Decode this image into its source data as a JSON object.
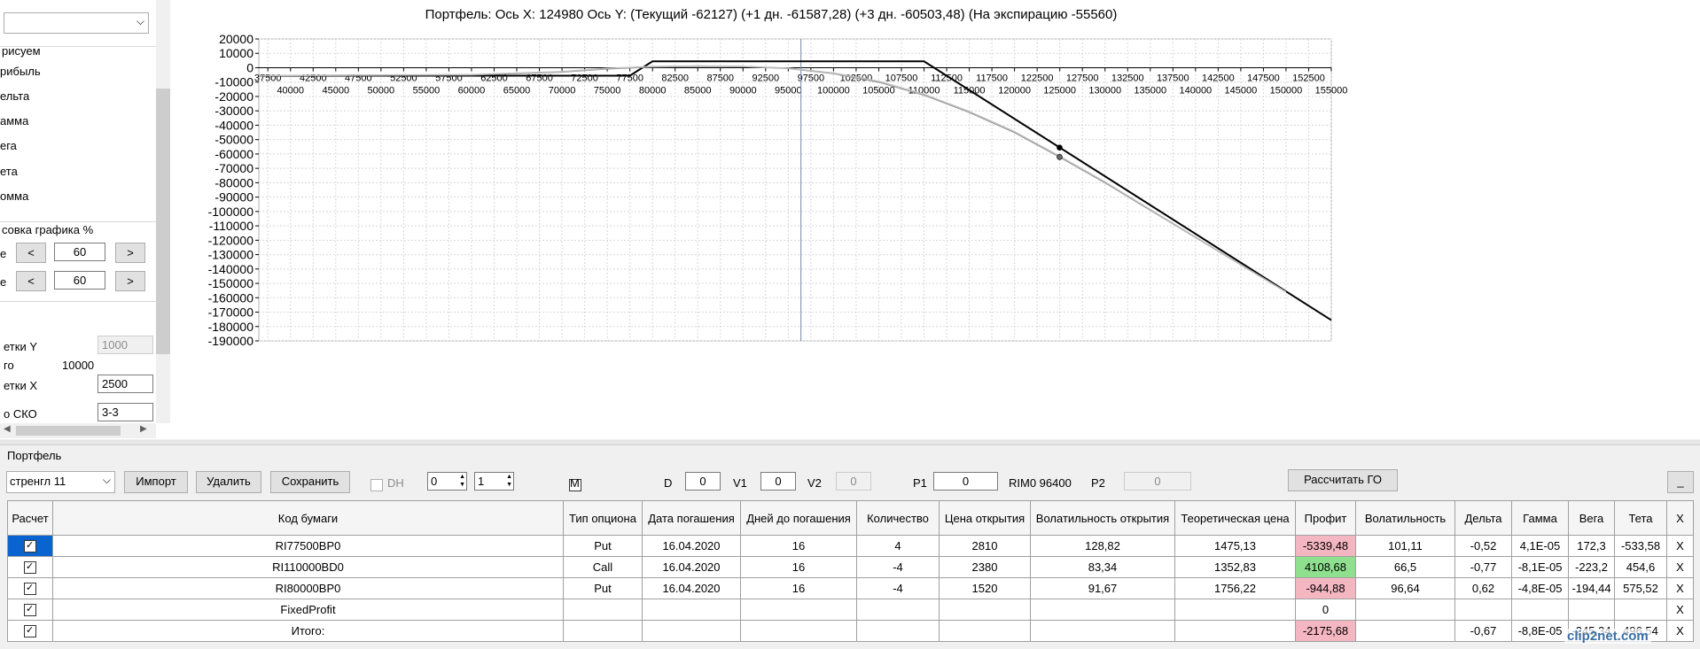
{
  "left_panel": {
    "top_combo_value": "",
    "draw_header": "рисуем",
    "checks": [
      "рибыль",
      "ельта",
      "амма",
      "ега",
      "ета",
      "омма"
    ],
    "scale_header": "совка графика %",
    "scale_row1_prefix": "е",
    "scale_row1_value": "60",
    "scale_row2_prefix": "е",
    "scale_row2_value": "60",
    "btn_less": "<",
    "btn_more": ">",
    "grid_y_label": "етки Y",
    "grid_y_value": "1000",
    "step_label": "го",
    "step_value": "10000",
    "grid_x_label": "етки X",
    "grid_x_value": "2500",
    "sko_label": "о СКО",
    "sko_value": "3-3"
  },
  "chart": {
    "title": "Портфель: Ось X: 124980 Ось Y:  (Текущий -62127)  (+1 дн. -61587,28)  (+3 дн. -60503,48)  (На экспирацию -55560)",
    "y_ticks": [
      20000,
      10000,
      0,
      -10000,
      -20000,
      -30000,
      -40000,
      -50000,
      -60000,
      -70000,
      -80000,
      -90000,
      -100000,
      -110000,
      -120000,
      -130000,
      -140000,
      -150000,
      -160000,
      -170000,
      -180000,
      -190000
    ],
    "x_ticks_upper": [
      37500,
      42500,
      47500,
      52500,
      57500,
      62500,
      67500,
      72500,
      77500,
      82500,
      87500,
      92500,
      97500,
      102500,
      107500,
      112500,
      117500,
      122500,
      127500,
      132500,
      137500,
      142500,
      147500,
      152500
    ],
    "x_ticks_lower": [
      40000,
      45000,
      50000,
      55000,
      60000,
      65000,
      70000,
      75000,
      80000,
      85000,
      90000,
      95000,
      100000,
      105000,
      110000,
      115000,
      120000,
      125000,
      130000,
      135000,
      140000,
      145000,
      150000,
      155000
    ],
    "cursor_x": 96400,
    "marker_x": 124980,
    "colors": {
      "expiration": "#000000",
      "current": "#9a9a9a",
      "cursor": "#7a8aa8",
      "grid": "#d8d8d8"
    }
  },
  "chart_data": {
    "type": "line",
    "title": "Портфель: Ось X: 124980 Ось Y:  (Текущий -62127)  (+1 дн. -61587,28)  (+3 дн. -60503,48)  (На экспирацию -55560)",
    "xlim": [
      36500,
      155000
    ],
    "ylim": [
      -190000,
      20000
    ],
    "series": [
      {
        "x": [
          36500,
          77500,
          80000,
          110000,
          155000
        ],
        "values": [
          -5560,
          -5560,
          4440,
          4440,
          -175560
        ]
      },
      {
        "x": [
          36500,
          60000,
          70000,
          75000,
          80000,
          85000,
          90000,
          95000,
          100000,
          105000,
          110000,
          115000,
          120000,
          125000,
          130000,
          140000,
          150000
        ],
        "values": [
          -5500,
          -5000,
          -3000,
          -800,
          500,
          1000,
          800,
          -500,
          -4000,
          -10000,
          -19000,
          -31000,
          -45000,
          -62127,
          -80000,
          -118000,
          -156000
        ]
      },
      {
        "x": [
          36500,
          60000,
          70000,
          75000,
          80000,
          85000,
          90000,
          95000,
          100000,
          105000,
          110000,
          115000,
          120000,
          125000,
          130000,
          140000,
          150000
        ],
        "values": [
          -5500,
          -4800,
          -2700,
          -500,
          800,
          1200,
          900,
          -300,
          -3700,
          -9500,
          -18500,
          -30500,
          -44500,
          -61587,
          -79500,
          -117800,
          -156000
        ]
      }
    ],
    "markers": [
      {
        "x": 124980,
        "y": -55560
      },
      {
        "x": 124980,
        "y": -62127
      }
    ]
  },
  "portfolio": {
    "group_label": "Портфель",
    "combo_value": "стренгл 11",
    "import_btn": "Импорт",
    "delete_btn": "Удалить",
    "save_btn": "Сохранить",
    "dh_label": "DH",
    "spin1_value": "0",
    "spin2_value": "1",
    "m_label": "M",
    "d_label": "D",
    "d_value": "0",
    "v1_label": "V1",
    "v1_value": "0",
    "v2_label": "V2",
    "v2_value": "0",
    "p1_label": "P1",
    "p1_value": "0",
    "rim_label": "RIM0 96400",
    "p2_label": "P2",
    "p2_value": "0",
    "calc_go_btn": "Рассчитать ГО",
    "minimize_btn": "_"
  },
  "table": {
    "headers": [
      "Расчет",
      "Код бумаги",
      "Тип опциона",
      "Дата погашения",
      "Дней до погашения",
      "Количество",
      "Цена открытия",
      "Волатильность открытия",
      "Теоретическая цена",
      "Профит",
      "Волатильность",
      "Дельта",
      "Гамма",
      "Вега",
      "Тета",
      "X"
    ],
    "rows": [
      [
        "",
        "RI77500BP0",
        "Put",
        "16.04.2020",
        "16",
        "4",
        "2810",
        "128,82",
        "1475,13",
        "-5339,48",
        "101,11",
        "-0,52",
        "4,1E-05",
        "172,3",
        "-533,58",
        "X"
      ],
      [
        "",
        "RI110000BD0",
        "Call",
        "16.04.2020",
        "16",
        "-4",
        "2380",
        "83,34",
        "1352,83",
        "4108,68",
        "66,5",
        "-0,77",
        "-8,1E-05",
        "-223,2",
        "454,6",
        "X"
      ],
      [
        "",
        "RI80000BP0",
        "Put",
        "16.04.2020",
        "16",
        "-4",
        "1520",
        "91,67",
        "1756,22",
        "-944,88",
        "96,64",
        "0,62",
        "-4,8E-05",
        "-194,44",
        "575,52",
        "X"
      ],
      [
        "",
        "FixedProfit",
        "",
        "",
        "",
        "",
        "",
        "",
        "",
        "0",
        "",
        "",
        "",
        "",
        "",
        "X"
      ],
      [
        "",
        "Итого:",
        "",
        "",
        "",
        "",
        "",
        "",
        "",
        "-2175,68",
        "",
        "-0,67",
        "-8,8E-05",
        "-245,34",
        "496,54",
        "X"
      ]
    ],
    "profit_colors": [
      "#f4b6c0",
      "#8ee08e",
      "#f4b6c0",
      "#ffffff",
      "#f4b6c0"
    ]
  },
  "watermark": "clip2net.com"
}
